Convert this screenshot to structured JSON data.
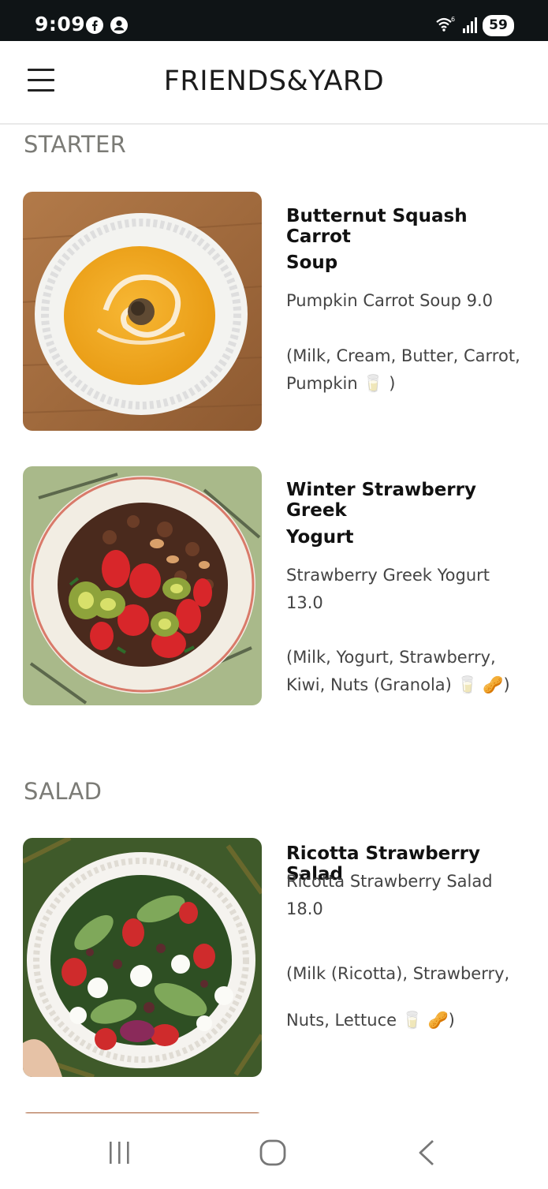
{
  "status_bar": {
    "time": "9:09",
    "battery": "59",
    "icons": [
      "facebook-icon",
      "account-icon",
      "wifi-icon",
      "signal-icon",
      "battery-icon"
    ]
  },
  "header": {
    "title": "FRIENDS&YARD",
    "menu_icon": "hamburger-menu-icon"
  },
  "sections": [
    {
      "title": "STARTER",
      "items": [
        {
          "name_line1": "Butternut Squash Carrot",
          "name_line2": "Soup",
          "desc_line1": "Pumpkin Carrot Soup 9.0",
          "allergens_line1": "(Milk, Cream, Butter, Carrot,",
          "allergens_line2": "Pumpkin 🥛 )",
          "image": "carrot-soup-photo"
        },
        {
          "name_line1": "Winter Strawberry Greek",
          "name_line2": "Yogurt",
          "desc_line1": "Strawberry Greek Yogurt",
          "desc_line2": "13.0",
          "allergens_line1": "(Milk, Yogurt, Strawberry,",
          "allergens_line2": "Kiwi, Nuts (Granola) 🥛 🥜)",
          "image": "strawberry-yogurt-photo"
        }
      ]
    },
    {
      "title": "SALAD",
      "items": [
        {
          "name_line1": "Ricotta Strawberry Salad",
          "desc_line1": "Ricotta Strawberry  Salad",
          "desc_line2": "18.0",
          "allergens_line1": "(Milk (Ricotta), Strawberry,",
          "allergens_line2": "Nuts, Lettuce 🥛 🥜)",
          "image": "ricotta-salad-photo"
        }
      ]
    }
  ],
  "nav_bar": {
    "icons": [
      "recent-apps-icon",
      "home-icon",
      "back-icon"
    ]
  }
}
